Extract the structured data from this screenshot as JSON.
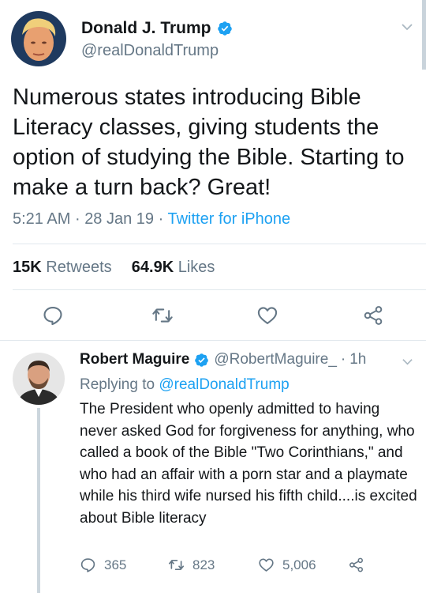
{
  "main_tweet": {
    "display_name": "Donald J. Trump",
    "handle": "@realDonaldTrump",
    "text": "Numerous states introducing Bible Literacy classes, giving students the option of studying the Bible. Starting to make a turn back? Great!",
    "time": "5:21 AM",
    "separator": "·",
    "date": "28 Jan 19",
    "source": "Twitter for iPhone",
    "retweets_count": "15K",
    "retweets_label": "Retweets",
    "likes_count": "64.9K",
    "likes_label": "Likes"
  },
  "reply": {
    "display_name": "Robert Maguire",
    "handle": "@RobertMaguire_",
    "separator": "·",
    "age": "1h",
    "replying_prefix": "Replying to",
    "replying_to": "@realDonaldTrump",
    "text": "The President who openly admitted to having never asked God for forgiveness for anything, who called a book of the Bible \"Two Corinthians,\" and who had an affair with a porn star and a playmate while his third wife nursed his fifth child....is excited about Bible literacy",
    "reply_count": "365",
    "retweet_count": "823",
    "like_count": "5,006"
  },
  "colors": {
    "accent": "#1da1f2",
    "secondary_text": "#657786",
    "primary_text": "#14171a",
    "divider": "#e1e8ed"
  },
  "icons": [
    "verified-badge-icon",
    "chevron-down-icon",
    "reply-icon",
    "retweet-icon",
    "like-icon",
    "share-icon"
  ]
}
